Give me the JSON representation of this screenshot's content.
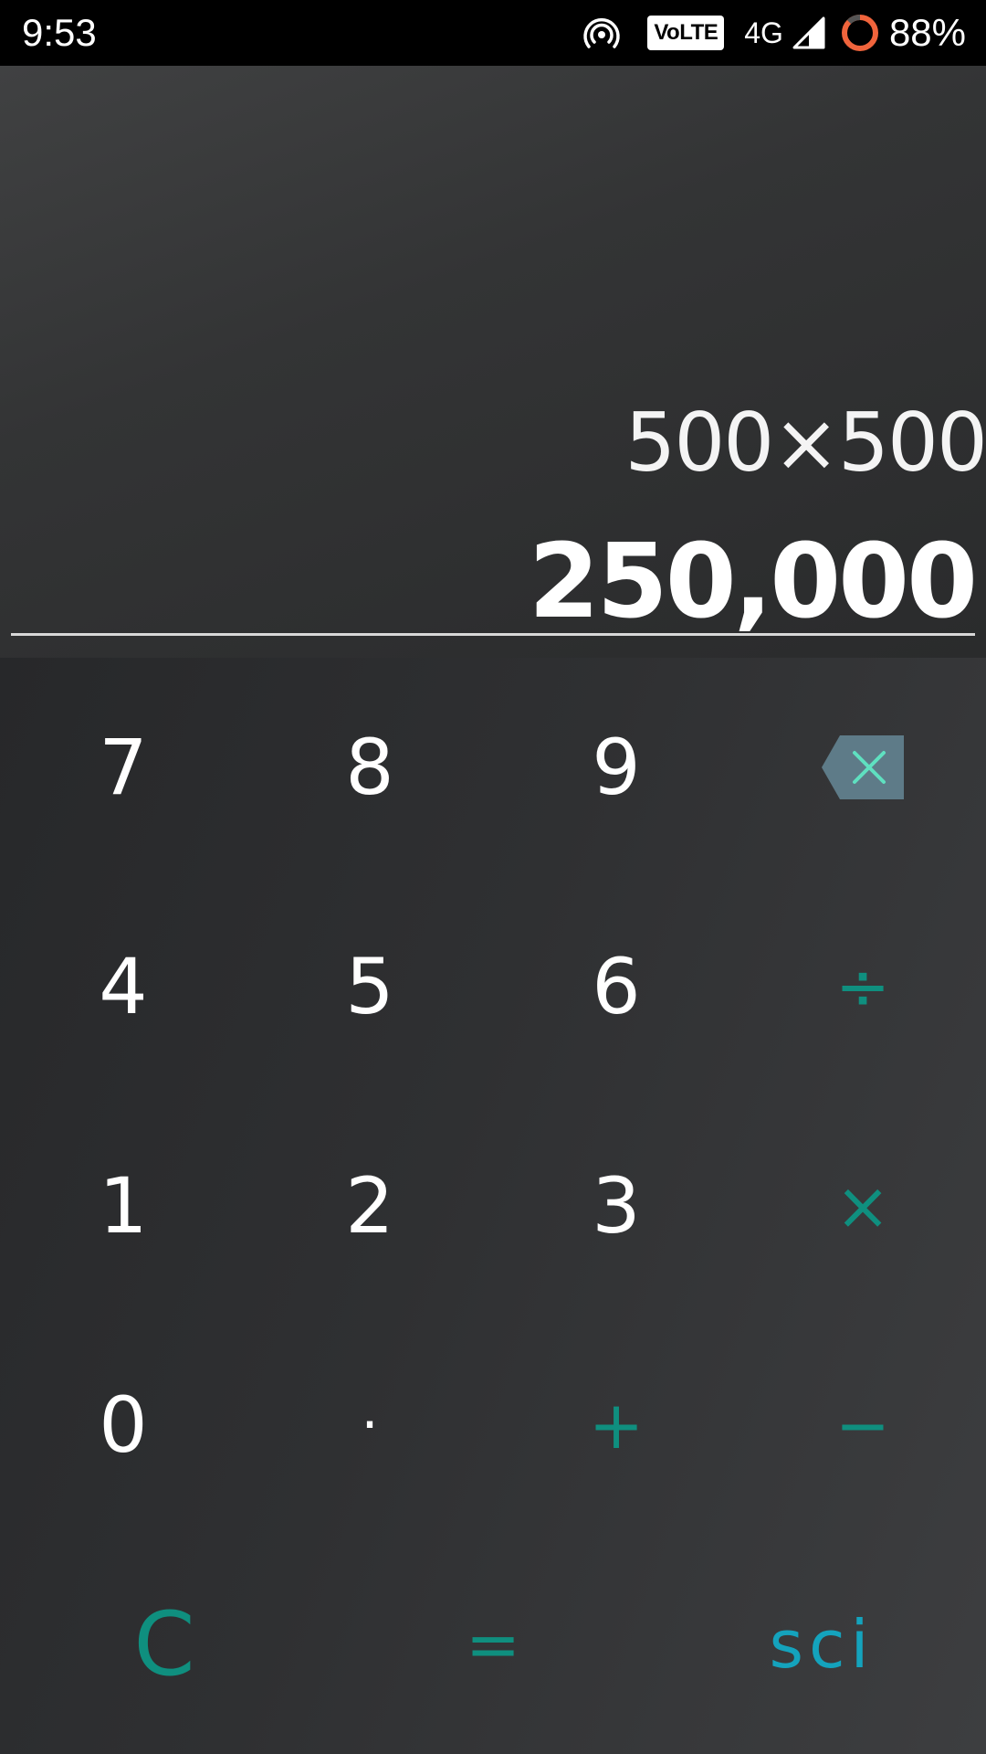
{
  "status_bar": {
    "time": "9:53",
    "volte": "VoLTE",
    "network": "4G",
    "battery": "88%",
    "icons": [
      "hotspot-icon",
      "signal-icon",
      "battery-ring-icon"
    ]
  },
  "display": {
    "expression": "500×500",
    "result": "250,000"
  },
  "keypad": {
    "row1": [
      "7",
      "8",
      "9"
    ],
    "row2": [
      "4",
      "5",
      "6"
    ],
    "row3": [
      "1",
      "2",
      "3"
    ],
    "row4": [
      "0",
      "·"
    ],
    "operators": {
      "divide": "÷",
      "multiply": "×",
      "plus": "+",
      "minus": "−"
    },
    "backspace_icon": "backspace-icon",
    "bottom": {
      "clear": "C",
      "equals": "=",
      "sci": "sci"
    }
  },
  "colors": {
    "accent": "#0f8f7f",
    "sci_accent": "#14a3bd",
    "backspace_bg": "#5e7b88",
    "backspace_x": "#5fe0c0"
  }
}
